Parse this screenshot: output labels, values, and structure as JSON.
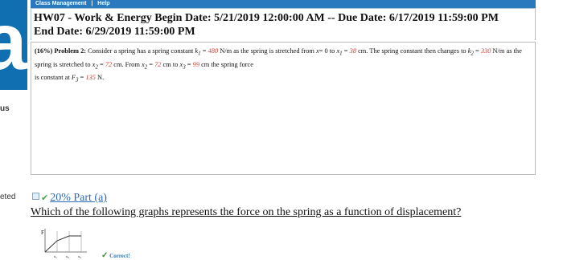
{
  "sidebar": {
    "logo_letter": "a",
    "fragment_1": "us",
    "fragment_2": "eted"
  },
  "topbar": {
    "menu_class_management": "Class Management",
    "separator": "|",
    "menu_help": "Help"
  },
  "header": {
    "line1": "HW07 - Work & Energy Begin Date: 5/21/2019 12:00:00 AM -- Due Date: 6/17/2019 11:59:00 PM",
    "line2": "End Date: 6/29/2019 11:59:00 PM"
  },
  "problem": {
    "percent": "(16%)",
    "label": "Problem 2:",
    "t1": "Consider a spring has a spring constant",
    "k1_sym": "k",
    "k1_sub": "1",
    "eq": "=",
    "k1_val": "480",
    "unit_nm": "N/m",
    "t2": "as the spring is stretched from",
    "x_sym": "x",
    "t3": "= 0 to",
    "x1_sym": "x",
    "x1_sub": "1",
    "x1_val": "38",
    "unit_cm": "cm.",
    "t4": "The",
    "t5": "spring constant then changes to",
    "k2_sym": "k",
    "k2_sub": "2",
    "k2_val": "330",
    "t6": "N/m as the spring is stretched to",
    "x2_sym": "x",
    "x2_sub": "2",
    "x2_val": "72",
    "t7": "cm. From",
    "x2b_val": "72",
    "t8": "cm to",
    "x3_sym": "x",
    "x3_sub": "3",
    "x3_val": "99",
    "t9": "cm the spring force",
    "t10": "is constant at",
    "f3_sym": "F",
    "f3_sub": "3",
    "f3_val": "135",
    "unit_n": "N."
  },
  "part_a": {
    "percent_part": "20% Part (a)",
    "question": "Which of the following graphs represents the force on the spring as a function of displacement?",
    "correct_label": "Correct!",
    "thumb_f": "F",
    "thumb_x1": "x₁",
    "thumb_x2": "x₂",
    "thumb_x3": "x₃"
  },
  "colors": {
    "accent": "#2a78bd",
    "value_red": "#d93b2f",
    "correct_green": "#4aa34a"
  },
  "icons": [
    "hint-box-icon",
    "check-icon",
    "checkmark-icon"
  ]
}
